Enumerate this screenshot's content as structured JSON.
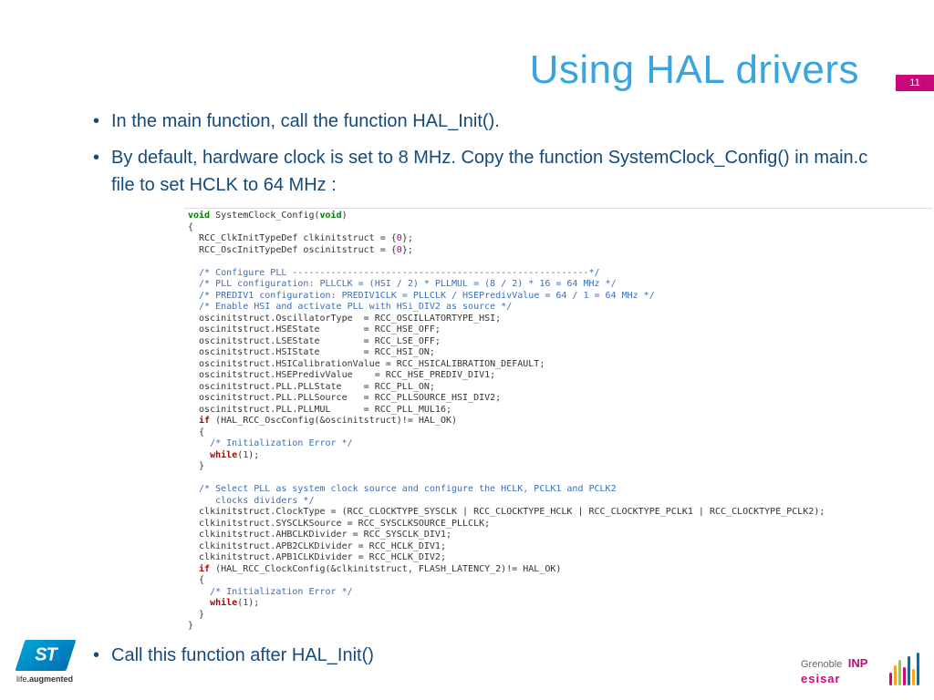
{
  "title": "Using HAL drivers",
  "pageNumber": "11",
  "bullets": {
    "b1": "In the main function, call the function HAL_Init().",
    "b2": "By default, hardware clock is set to 8 MHz. Copy the function SystemClock_Config() in main.c file to set HCLK to 64 MHz :",
    "b3": "Call this function after HAL_Init()"
  },
  "code": {
    "kw_void1": "void",
    "sig": " SystemClock_Config(",
    "kw_void2": "void",
    "sig_end": ")",
    "brace_open": "{",
    "l1": "  RCC_ClkInitTypeDef clkinitstruct = {",
    "n0a": "0",
    "l1b": "};",
    "l2": "  RCC_OscInitTypeDef oscinitstruct = {",
    "n0b": "0",
    "l2b": "};",
    "c1": "  /* Configure PLL ------------------------------------------------------*/",
    "c2": "  /* PLL configuration: PLLCLK = (HSI / 2) * PLLMUL = (8 / 2) * 16 = 64 MHz */",
    "c3": "  /* PREDIV1 configuration: PREDIV1CLK = PLLCLK / HSEPredivValue = 64 / 1 = 64 MHz */",
    "c4": "  /* Enable HSI and activate PLL with HSi_DIV2 as source */",
    "l3": "  oscinitstruct.OscillatorType  = RCC_OSCILLATORTYPE_HSI;",
    "l4": "  oscinitstruct.HSEState        = RCC_HSE_OFF;",
    "l5": "  oscinitstruct.LSEState        = RCC_LSE_OFF;",
    "l6": "  oscinitstruct.HSIState        = RCC_HSI_ON;",
    "l7": "  oscinitstruct.HSICalibrationValue = RCC_HSICALIBRATION_DEFAULT;",
    "l8": "  oscinitstruct.HSEPredivValue    = RCC_HSE_PREDIV_DIV1;",
    "l9": "  oscinitstruct.PLL.PLLState    = RCC_PLL_ON;",
    "l10": "  oscinitstruct.PLL.PLLSource   = RCC_PLLSOURCE_HSI_DIV2;",
    "l11": "  oscinitstruct.PLL.PLLMUL      = RCC_PLL_MUL16;",
    "kw_if1": "  if",
    "l12": " (HAL_RCC_OscConfig(&oscinitstruct)!= HAL_OK)",
    "l13": "  {",
    "c5": "    /* Initialization Error */",
    "kw_wh1": "    while",
    "l14a": "(",
    "n1a": "1",
    "l14b": ");",
    "l15": "  }",
    "c6": "  /* Select PLL as system clock source and configure the HCLK, PCLK1 and PCLK2",
    "c6b": "     clocks dividers */",
    "l16": "  clkinitstruct.ClockType = (RCC_CLOCKTYPE_SYSCLK | RCC_CLOCKTYPE_HCLK | RCC_CLOCKTYPE_PCLK1 | RCC_CLOCKTYPE_PCLK2);",
    "l17": "  clkinitstruct.SYSCLKSource = RCC_SYSCLKSOURCE_PLLCLK;",
    "l18": "  clkinitstruct.AHBCLKDivider = RCC_SYSCLK_DIV1;",
    "l19": "  clkinitstruct.APB2CLKDivider = RCC_HCLK_DIV1;",
    "l20": "  clkinitstruct.APB1CLKDivider = RCC_HCLK_DIV2;",
    "kw_if2": "  if",
    "l21": " (HAL_RCC_ClockConfig(&clkinitstruct, FLASH_LATENCY_2)!= HAL_OK)",
    "l22": "  {",
    "c7": "    /* Initialization Error */",
    "kw_wh2": "    while",
    "l23a": "(",
    "n1b": "1",
    "l23b": ");",
    "l24": "  }",
    "brace_close": "}"
  },
  "footer": {
    "stTag1": "life",
    "stTag2": ".augmented",
    "inp1": "Grenoble",
    "inp2": "INP",
    "inpSub": "esisar"
  }
}
